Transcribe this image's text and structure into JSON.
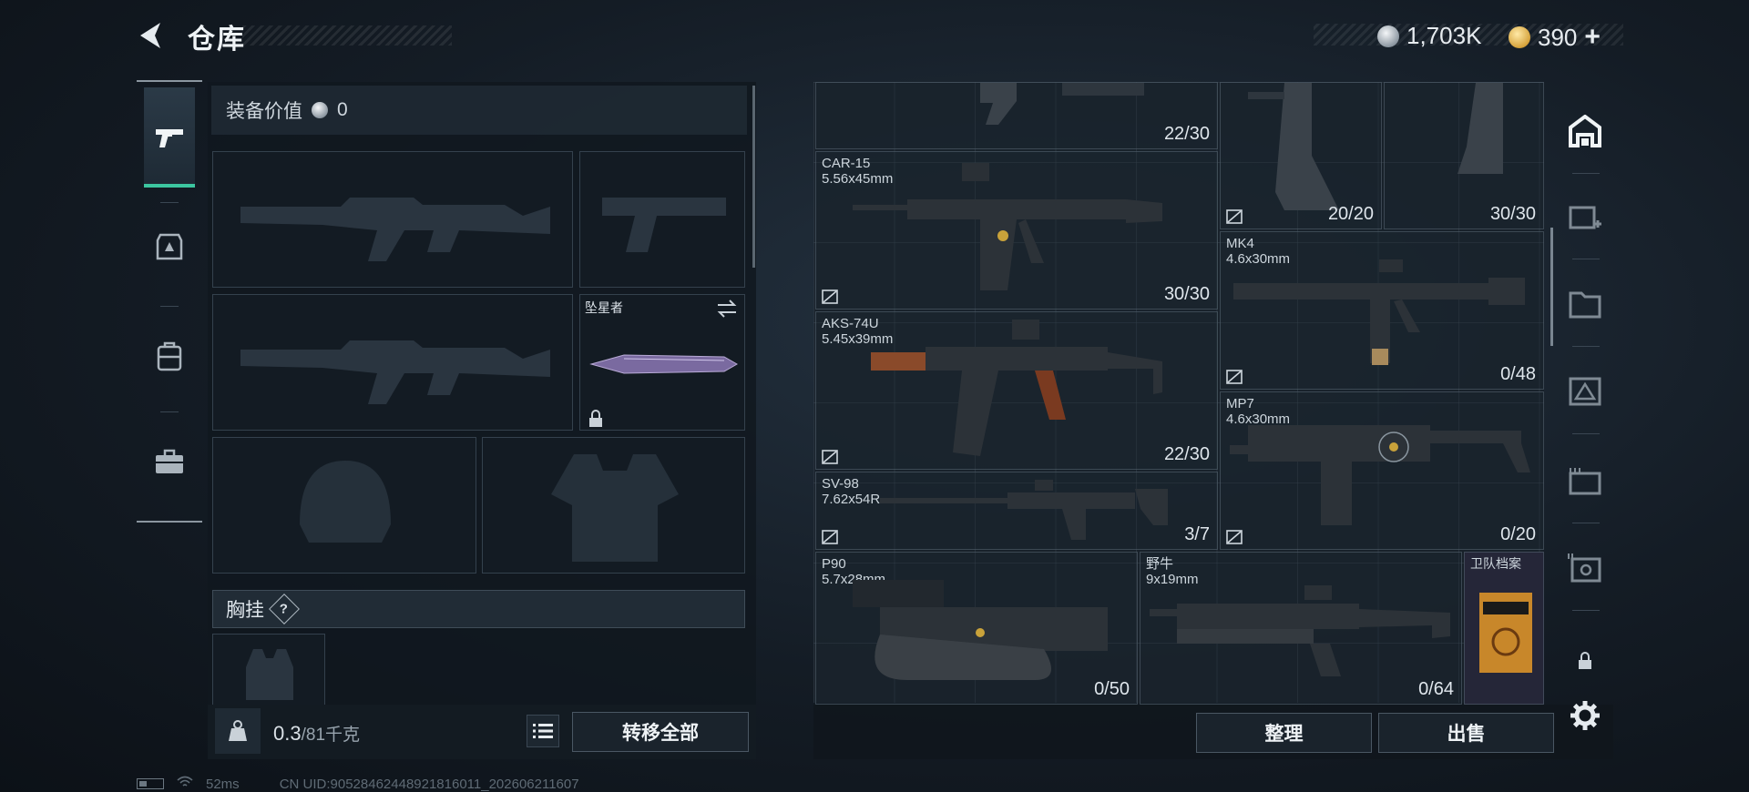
{
  "header": {
    "title": "仓库",
    "currency_silver": "1,703K",
    "currency_gold": "390",
    "plus": "+"
  },
  "loadout": {
    "equip_value_label": "装备价值",
    "equip_value": "0",
    "melee_name": "坠星者",
    "rig_label": "胸挂",
    "rig_help": "?",
    "weight_current": "0.3",
    "weight_max": "/81千克",
    "transfer_all": "转移全部"
  },
  "storage": {
    "items": [
      {
        "name": "",
        "caliber": "",
        "ammo": "22/30"
      },
      {
        "name": "",
        "caliber": "",
        "ammo": "20/20"
      },
      {
        "name": "",
        "caliber": "",
        "ammo": "30/30"
      },
      {
        "name": "CAR-15",
        "caliber": "5.56x45mm",
        "ammo": "30/30"
      },
      {
        "name": "MK4",
        "caliber": "4.6x30mm",
        "ammo": "0/48"
      },
      {
        "name": "AKS-74U",
        "caliber": "5.45x39mm",
        "ammo": "22/30"
      },
      {
        "name": "MP7",
        "caliber": "4.6x30mm",
        "ammo": "0/20"
      },
      {
        "name": "SV-98",
        "caliber": "7.62x54R",
        "ammo": "3/7"
      },
      {
        "name": "P90",
        "caliber": "5.7x28mm",
        "ammo": "0/50"
      },
      {
        "name": "野牛",
        "caliber": "9x19mm",
        "ammo": "0/64"
      },
      {
        "name": "卫队档案",
        "caliber": "",
        "ammo": ""
      }
    ],
    "sort_label": "整理",
    "sell_label": "出售"
  },
  "status": {
    "ping": "52ms",
    "uid": "CN UID:90528462448921816011_202606211607"
  },
  "colors": {
    "accent_tab": "#3cc6a0",
    "panel_bg": "#18212a",
    "gold_coin": "#d6a33c",
    "silver_coin": "#8d98a2"
  },
  "icons": {
    "back": "back-arrow-icon",
    "weapons_tab": "pistol-icon",
    "armor_tab": "armor-icon",
    "bag_tab": "backpack-icon",
    "case_tab": "briefcase-icon",
    "settings": "gear-icon"
  }
}
